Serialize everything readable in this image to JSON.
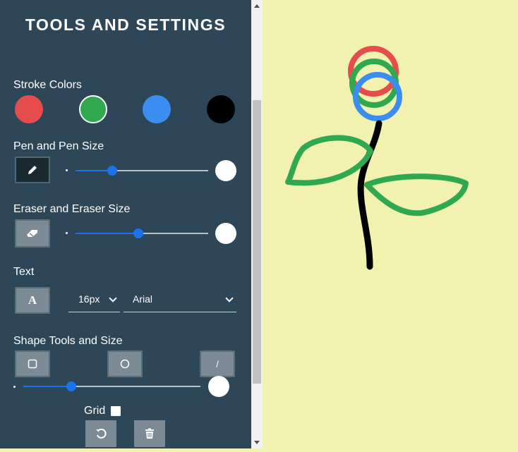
{
  "sidebar": {
    "title": "TOOLS AND SETTINGS",
    "stroke_colors_label": "Stroke Colors",
    "colors": [
      {
        "name": "red",
        "hex": "#e74c4c",
        "selected": false
      },
      {
        "name": "green",
        "hex": "#2fa84f",
        "selected": true
      },
      {
        "name": "blue",
        "hex": "#3b8ef0",
        "selected": false
      },
      {
        "name": "black",
        "hex": "#000000",
        "selected": false
      }
    ],
    "pen_label": "Pen and Pen Size",
    "pen_size_fraction": 0.28,
    "eraser_label": "Eraser and Eraser Size",
    "eraser_size_fraction": 0.48,
    "text_label": "Text",
    "text_size_value": "16px",
    "text_font_value": "Arial",
    "shape_label": "Shape Tools and Size",
    "line_tool_glyph": "/",
    "shape_size_fraction": 0.27,
    "grid_label": "Grid",
    "grid_checked": false
  },
  "canvas": {
    "background": "#f2f2b0",
    "drawing": "flower sketch with red, green and blue rings, black stem and two green leaves"
  }
}
